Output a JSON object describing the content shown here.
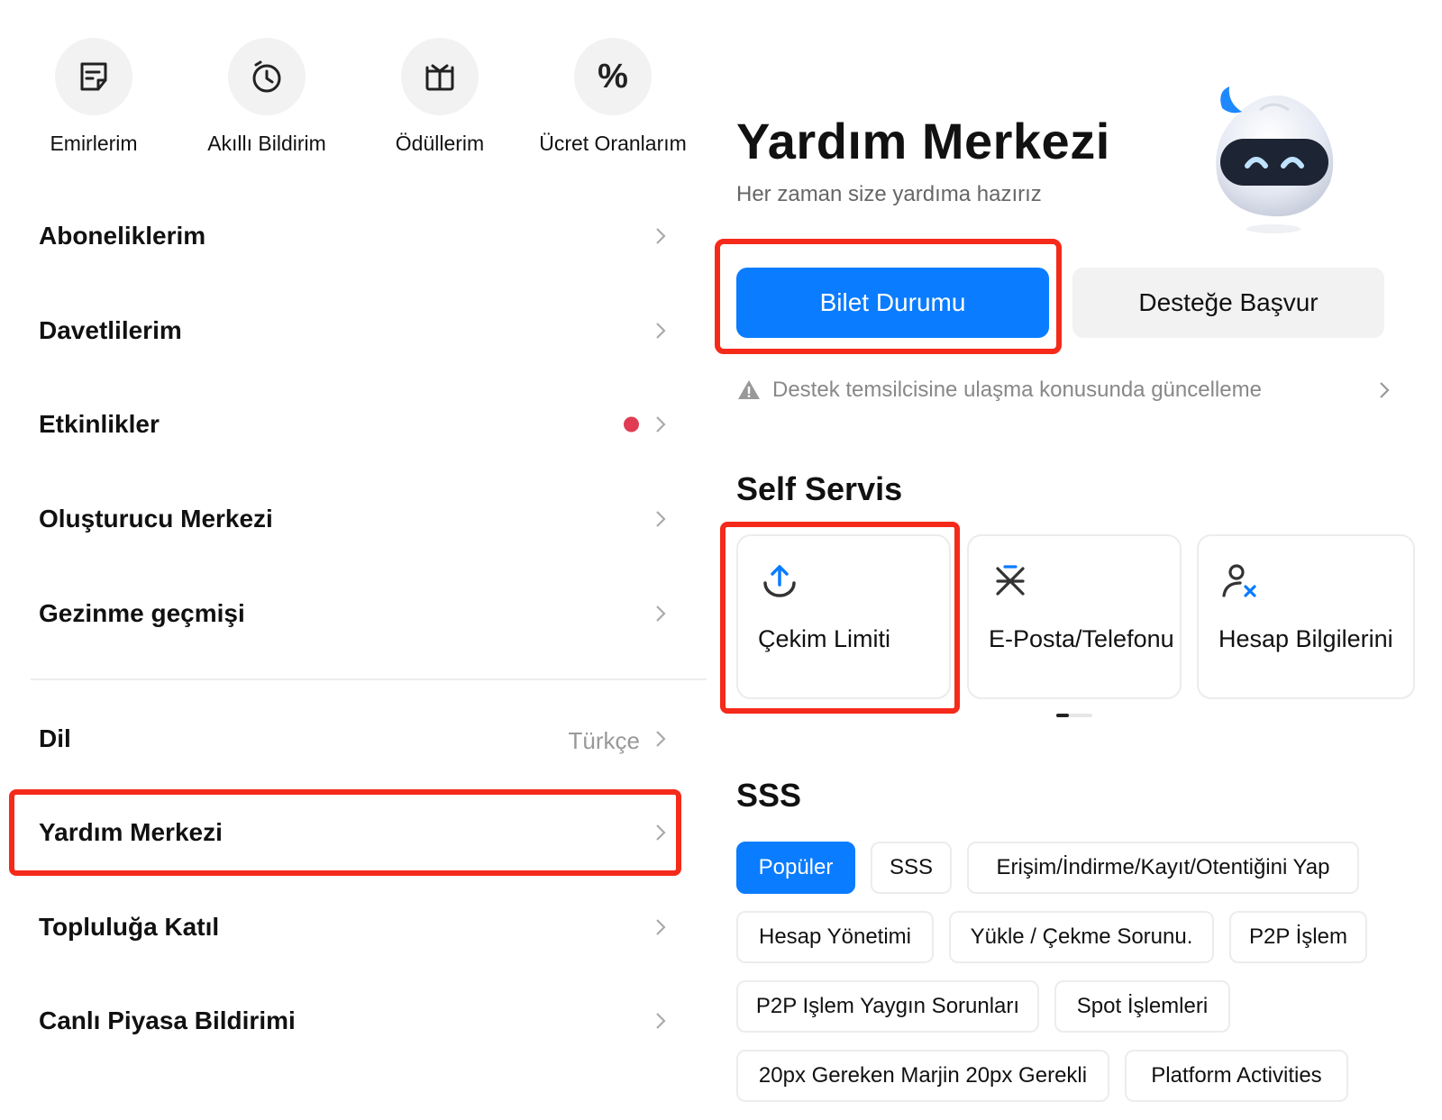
{
  "quick_actions": [
    {
      "label": "Emirlerim",
      "icon": "orders-icon"
    },
    {
      "label": "Akıllı Bildirim",
      "icon": "clock-icon"
    },
    {
      "label": "Ödüllerim",
      "icon": "gift-icon"
    },
    {
      "label": "Ücret Oranlarım",
      "icon": "percent-icon"
    }
  ],
  "menu": {
    "subscriptions": "Aboneliklerim",
    "invitees": "Davetlilerim",
    "events": "Etkinlikler",
    "creator_center": "Oluşturucu Merkezi",
    "browsing_history": "Gezinme geçmişi",
    "language": "Dil",
    "language_value": "Türkçe",
    "help_center": "Yardım Merkezi",
    "join_community": "Topluluğa Katıl",
    "live_market": "Canlı Piyasa Bildirimi"
  },
  "help": {
    "title": "Yardım Merkezi",
    "subtitle": "Her zaman size yardıma hazırız",
    "ticket_button": "Bilet Durumu",
    "support_button": "Desteğe Başvur",
    "notice": "Destek temsilcisine ulaşma konusunda güncelleme"
  },
  "self_service": {
    "title": "Self Servis",
    "cards": [
      {
        "label": "Çekim Limiti",
        "icon": "upload-arrow-icon"
      },
      {
        "label": "E-Posta/Telefonu",
        "icon": "asterisk-icon"
      },
      {
        "label": "Hesap Bilgilerini",
        "icon": "user-remove-icon"
      }
    ]
  },
  "faq": {
    "title": "SSS",
    "chips": [
      "Popüler",
      "SSS",
      "Erişim/İndirme/Kayıt/Otentiğini Yap",
      "Hesap Yönetimi",
      "Yükle / Çekme Sorunu.",
      "P2P İşlem",
      "P2P Işlem Yaygın Sorunları",
      "Spot İşlemleri",
      "20px Gereken Marjin 20px Gerekli",
      "Platform Activities"
    ],
    "active_chip": "Popüler"
  },
  "colors": {
    "accent": "#0a7cff",
    "highlight": "#f52a1a",
    "notification_dot": "#e03c53"
  }
}
